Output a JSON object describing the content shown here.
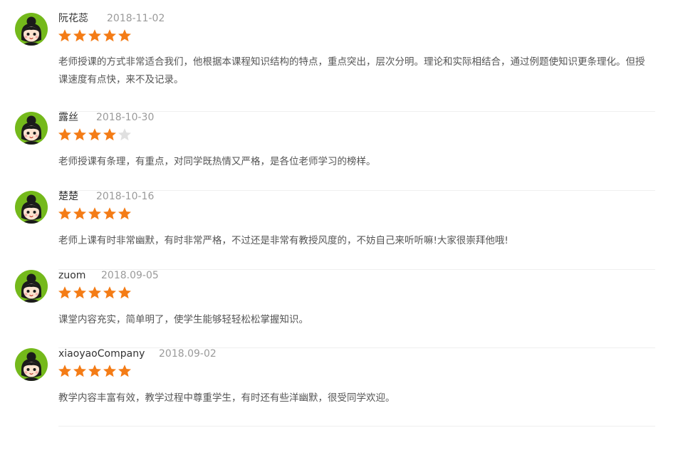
{
  "colors": {
    "star_on": "#f47c16",
    "star_off": "#e0e0e0",
    "avatar_bg": "#74b91b"
  },
  "reviews": [
    {
      "name": "阮花蕊",
      "date": "2018-11-02",
      "rating": 5,
      "content": "老师授课的方式非常适合我们，他根据本课程知识结构的特点，重点突出，层次分明。理论和实际相结合，通过例题使知识更条理化。但授课速度有点快，来不及记录。"
    },
    {
      "name": "露丝",
      "date": "2018-10-30",
      "rating": 4,
      "content": "老师授课有条理，有重点，对同学既热情又严格，是各位老师学习的榜样。"
    },
    {
      "name": "楚楚",
      "date": "2018-10-16",
      "rating": 5,
      "content": "老师上课有时非常幽默，有时非常严格，不过还是非常有教授风度的，不妨自己来听听嘛!大家很崇拜他哦!"
    },
    {
      "name": "zuom",
      "date": "2018.09-05",
      "rating": 5,
      "content": "课堂内容充实，简单明了，使学生能够轻轻松松掌握知识。"
    },
    {
      "name": "xiaoyaoCompany",
      "date": "2018.09-02",
      "rating": 5,
      "content": "教学内容丰富有效，教学过程中尊重学生，有时还有些洋幽默，很受同学欢迎。"
    }
  ]
}
